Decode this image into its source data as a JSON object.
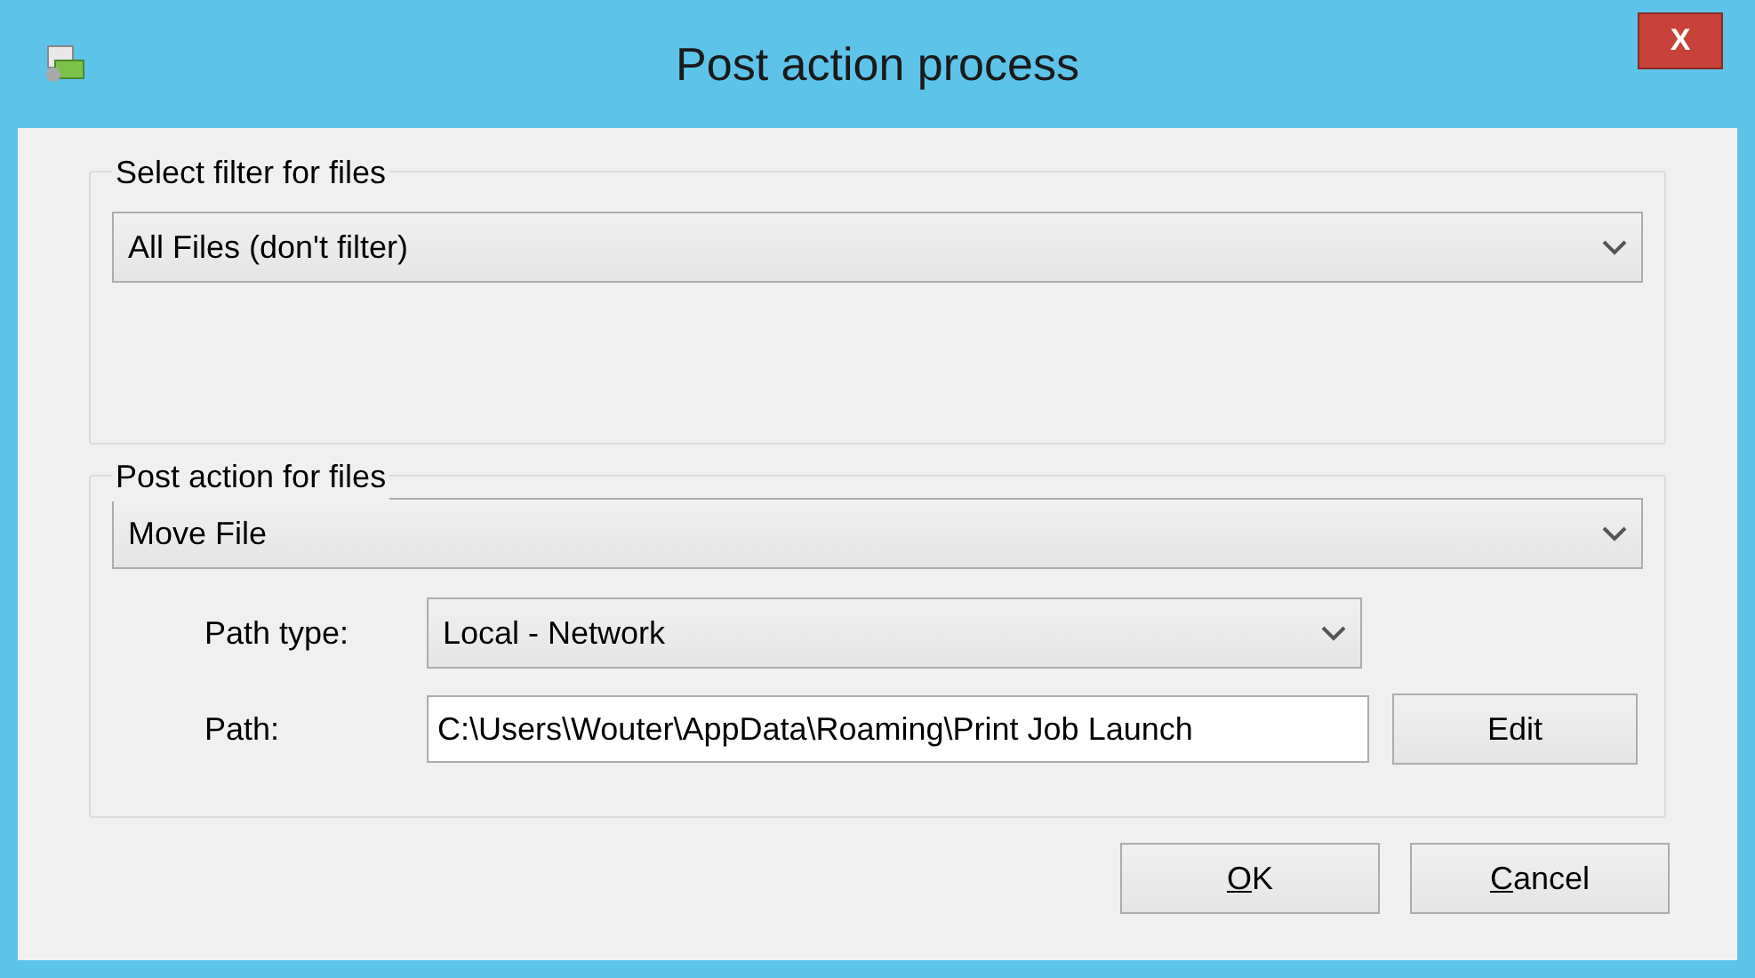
{
  "window": {
    "title": "Post action process",
    "close": "X"
  },
  "filter_group": {
    "legend": "Select filter for files",
    "combo": {
      "value": "All Files (don't filter)"
    }
  },
  "action_group": {
    "legend": "Post action for files",
    "combo": {
      "value": "Move File"
    },
    "path_type": {
      "label": "Path type:",
      "value": "Local - Network"
    },
    "path": {
      "label": "Path:",
      "value": "C:\\Users\\Wouter\\AppData\\Roaming\\Print Job Launch",
      "button": "Edit"
    }
  },
  "buttons": [
    {
      "label": "OK",
      "accelerator": true
    },
    {
      "label": "Cancel",
      "accelerator": true
    }
  ]
}
